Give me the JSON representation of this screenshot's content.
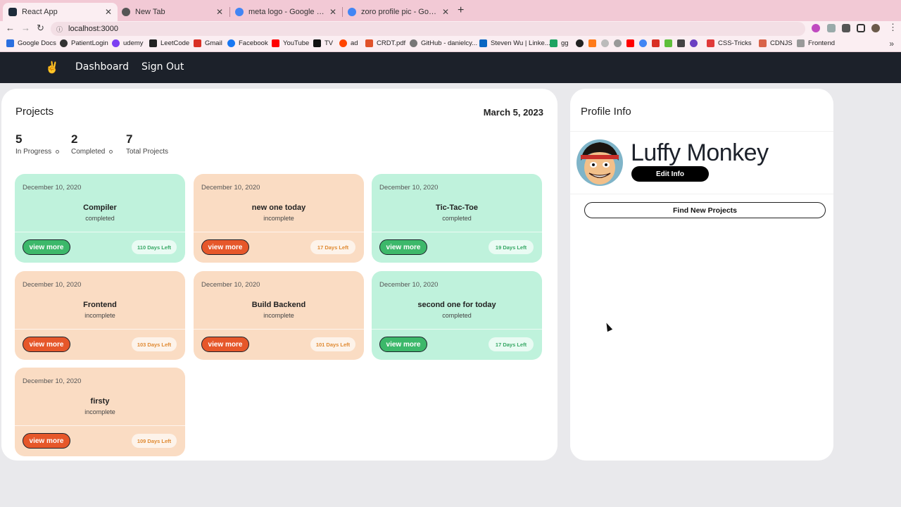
{
  "browser": {
    "tabs": [
      {
        "title": "React App",
        "favicon_color": "#1c2b3a"
      },
      {
        "title": "New Tab",
        "favicon_color": "#555555"
      },
      {
        "title": "meta logo - Google Search",
        "favicon_color": "#4285f4"
      },
      {
        "title": "zoro profile pic - Google Search",
        "favicon_color": "#4285f4"
      }
    ],
    "new_tab_label": "+",
    "url": "localhost:3000",
    "bookmarks": [
      {
        "label": "Google Docs",
        "color": "#2a6fe0"
      },
      {
        "label": "PatientLogin",
        "color": "#333333"
      },
      {
        "label": "udemy",
        "color": "#7b3ff2"
      },
      {
        "label": "LeetCode",
        "color": "#222222"
      },
      {
        "label": "Gmail",
        "color": "#d93025"
      },
      {
        "label": "Facebook",
        "color": "#1877f2"
      },
      {
        "label": "YouTube",
        "color": "#ff0000"
      },
      {
        "label": "TV",
        "color": "#111111"
      },
      {
        "label": "ad",
        "color": "#ff4500"
      },
      {
        "label": "CRDT.pdf",
        "color": "#e0522a"
      },
      {
        "label": "GitHub - danielcy...",
        "color": "#777777"
      },
      {
        "label": "Steven Wu | Linke...",
        "color": "#0a66c2"
      },
      {
        "label": "gg",
        "color": "#1ea362"
      },
      {
        "label": "CSS-Tricks",
        "color": "#e03a3a"
      },
      {
        "label": "CDNJS",
        "color": "#d9644a"
      },
      {
        "label": "Frontend",
        "color": "#999999"
      }
    ]
  },
  "app": {
    "nav": {
      "dashboard": "Dashboard",
      "signout": "Sign Out"
    },
    "projects": {
      "title": "Projects",
      "date": "March 5, 2023",
      "stats": [
        {
          "value": "5",
          "label": "In Progress"
        },
        {
          "value": "2",
          "label": "Completed"
        },
        {
          "value": "7",
          "label": "Total Projects"
        }
      ],
      "button_label": "view more",
      "cards": [
        {
          "date": "December 10, 2020",
          "name": "Compiler",
          "status": "completed",
          "days": "110 Days Left",
          "tone": "green"
        },
        {
          "date": "December 10, 2020",
          "name": "new one today",
          "status": "incomplete",
          "days": "17 Days Left",
          "tone": "orange"
        },
        {
          "date": "December 10, 2020",
          "name": "Tic-Tac-Toe",
          "status": "completed",
          "days": "19 Days Left",
          "tone": "green"
        },
        {
          "date": "December 10, 2020",
          "name": "Frontend",
          "status": "incomplete",
          "days": "103 Days Left",
          "tone": "orange"
        },
        {
          "date": "December 10, 2020",
          "name": "Build Backend",
          "status": "incomplete",
          "days": "101 Days Left",
          "tone": "orange"
        },
        {
          "date": "December 10, 2020",
          "name": "second one for today",
          "status": "completed",
          "days": "17 Days Left",
          "tone": "green"
        },
        {
          "date": "December 10, 2020",
          "name": "firsty",
          "status": "incomplete",
          "days": "109 Days Left",
          "tone": "orange"
        }
      ]
    },
    "profile": {
      "title": "Profile Info",
      "name": "Luffy Monkey",
      "edit_label": "Edit Info",
      "find_label": "Find New Projects"
    }
  }
}
